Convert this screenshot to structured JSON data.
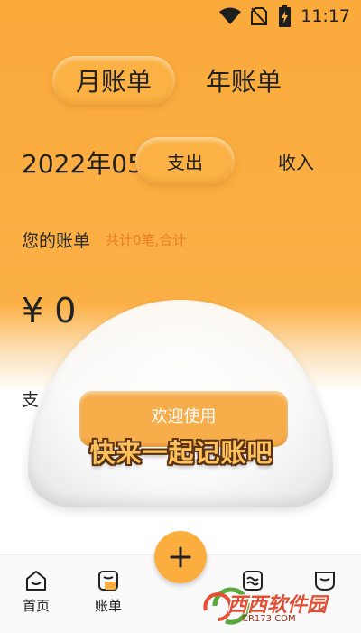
{
  "status_bar": {
    "time": "11:17",
    "icons": [
      "wifi-icon",
      "no-sim-icon",
      "battery-charging-icon"
    ]
  },
  "period_tabs": {
    "month": "月账单",
    "year": "年账单",
    "selected": "月账单"
  },
  "filter": {
    "date": "2022年05",
    "expense": "支出",
    "income": "收入",
    "selected": "支出"
  },
  "bills": {
    "label": "您的账单",
    "summary": "共计0笔,合计",
    "total": "¥ 0",
    "section_label": "支"
  },
  "welcome": {
    "button": "欢迎使用",
    "slogan": "快来一起记账吧"
  },
  "tabbar": {
    "items": [
      {
        "label": "首页",
        "icon": "home-icon"
      },
      {
        "label": "账单",
        "icon": "bill-icon"
      },
      {
        "label": "",
        "icon": "chart-icon"
      },
      {
        "label": "",
        "icon": "profile-icon"
      }
    ],
    "fab": "plus-icon"
  },
  "watermark": {
    "text": "西西软件园",
    "domain": "CR173.COM"
  },
  "colors": {
    "accent": "#fbb143",
    "summary": "#e87e1f"
  }
}
